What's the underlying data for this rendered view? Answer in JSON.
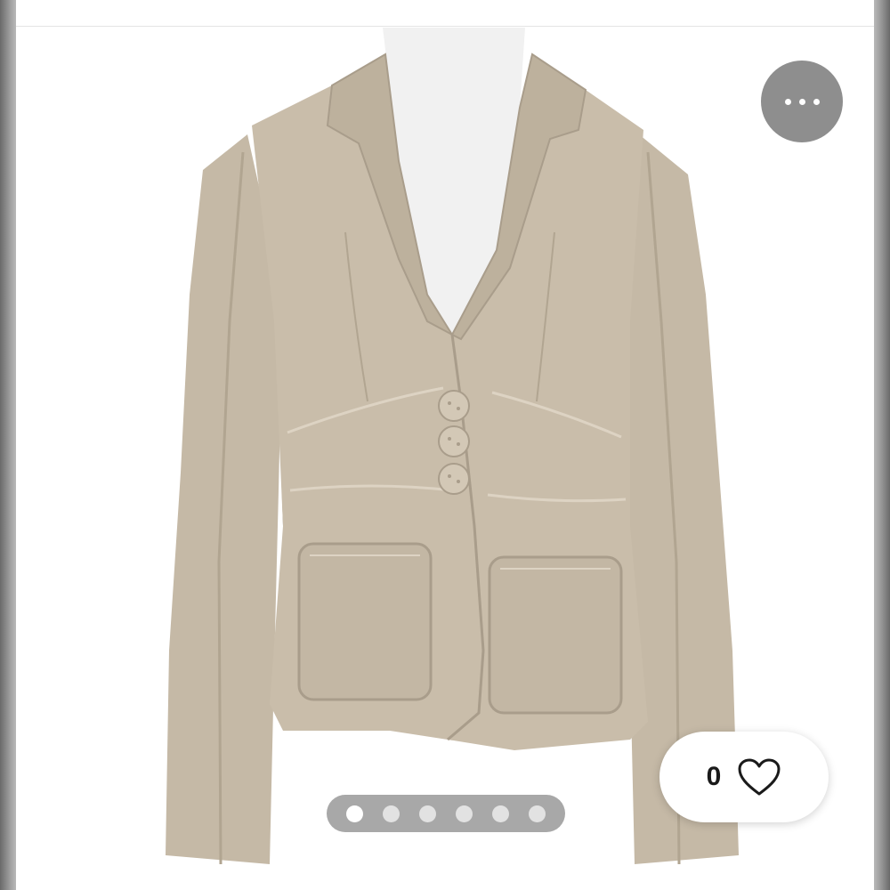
{
  "product_image": {
    "subject": "jacket-photo",
    "colors": {
      "fabric": "#c8bcaa",
      "fabric_shadow": "#a99d8b",
      "stitch": "#ddd3c3",
      "mannequin": "#f1f1f1"
    }
  },
  "more_button": {
    "icon": "ellipsis-icon",
    "background": "#8e8e8e"
  },
  "likes": {
    "count": "0",
    "icon": "heart-outline-icon"
  },
  "pagination": {
    "total": 6,
    "active_index": 0,
    "background": "#a8a8a8"
  }
}
